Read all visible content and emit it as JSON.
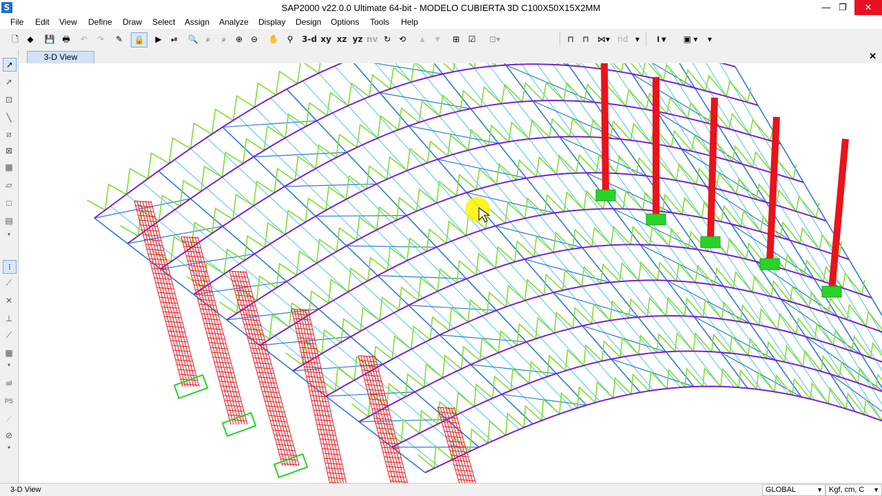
{
  "window": {
    "title": "SAP2000 v22.0.0 Ultimate 64-bit - MODELO CUBIERTA 3D C100X50X15X2MM",
    "app_icon_letter": "S"
  },
  "menu": {
    "items": [
      "File",
      "Edit",
      "View",
      "Define",
      "Draw",
      "Select",
      "Assign",
      "Analyze",
      "Display",
      "Design",
      "Options",
      "Tools",
      "Help"
    ]
  },
  "toolbar": {
    "view_3d": "3-d",
    "view_xy": "xy",
    "view_xz": "xz",
    "view_yz": "yz",
    "view_nv": "nv",
    "view_nd": "nd"
  },
  "view": {
    "tab_label": "3-D View"
  },
  "status": {
    "left_text": "3-D View",
    "coord_system": "GLOBAL",
    "units": "Kgf, cm, C"
  },
  "left_toolbar": {
    "label_all": "all",
    "label_ps": "PS"
  },
  "colors": {
    "arch": "#7a1fd6",
    "grid": "#2b7bd6",
    "purlin": "#49c8e8",
    "truss": "#7ee02a",
    "column": "#e8141a",
    "support": "#28d428"
  }
}
